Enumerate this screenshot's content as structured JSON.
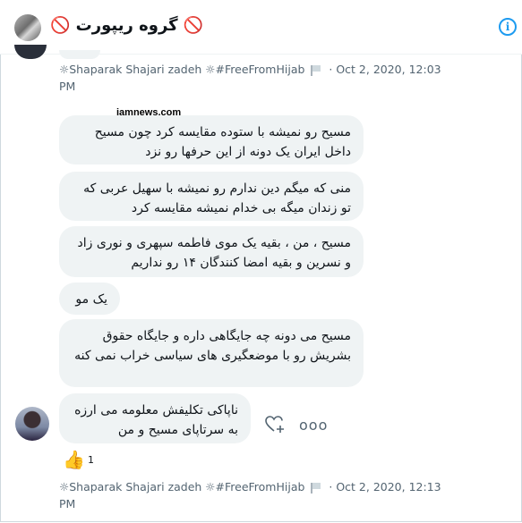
{
  "header": {
    "title": "🚫 گروه ریپورت 🚫",
    "info_icon": "info-icon"
  },
  "watermark": "jamnews.com",
  "meta_top": {
    "sender": "☼Shaparak Shajari zadeh ☼#FreeFromHijab",
    "timestamp": "· Oct 2, 2020, 12:03",
    "timestamp_cont": "PM"
  },
  "messages": [
    "مسیح رو نمیشه با ستوده مقایسه کرد چون مسیح داخل ایران یک دونه از این حرفها رو نزد",
    "منی که میگم دین ندارم رو نمیشه با سهیل عربی که تو زندان میگه بی خدام نمیشه مقایسه کرد",
    "مسیح ، من ، بقیه یک موی فاطمه سپهری و نوری زاد و نسرین و بقیه امضا کنندگان ۱۴ رو نداریم",
    "یک مو",
    "مسیح می دونه چه جایگاهی داره و جایگاه حقوق بشریش رو با موضعگیری های سیاسی خراب نمی کنه",
    "ناپاکی تکلیفش معلومه می ارزه به سرتاپای مسیح و من"
  ],
  "reaction": {
    "emoji": "👍",
    "count": "1"
  },
  "meta_bottom": {
    "sender": "☼Shaparak Shajari zadeh ☼#FreeFromHijab",
    "timestamp": "· Oct 2, 2020, 12:13",
    "timestamp_cont": "PM"
  },
  "icons": [
    "no-entry-icon",
    "info-icon",
    "flag-icon",
    "add-reaction-icon",
    "more-icon",
    "thumbs-up-icon"
  ],
  "colors": {
    "accent": "#1d9bf0",
    "bubble": "#eff3f4",
    "meta": "#536471",
    "no_entry": "#e0245e"
  }
}
